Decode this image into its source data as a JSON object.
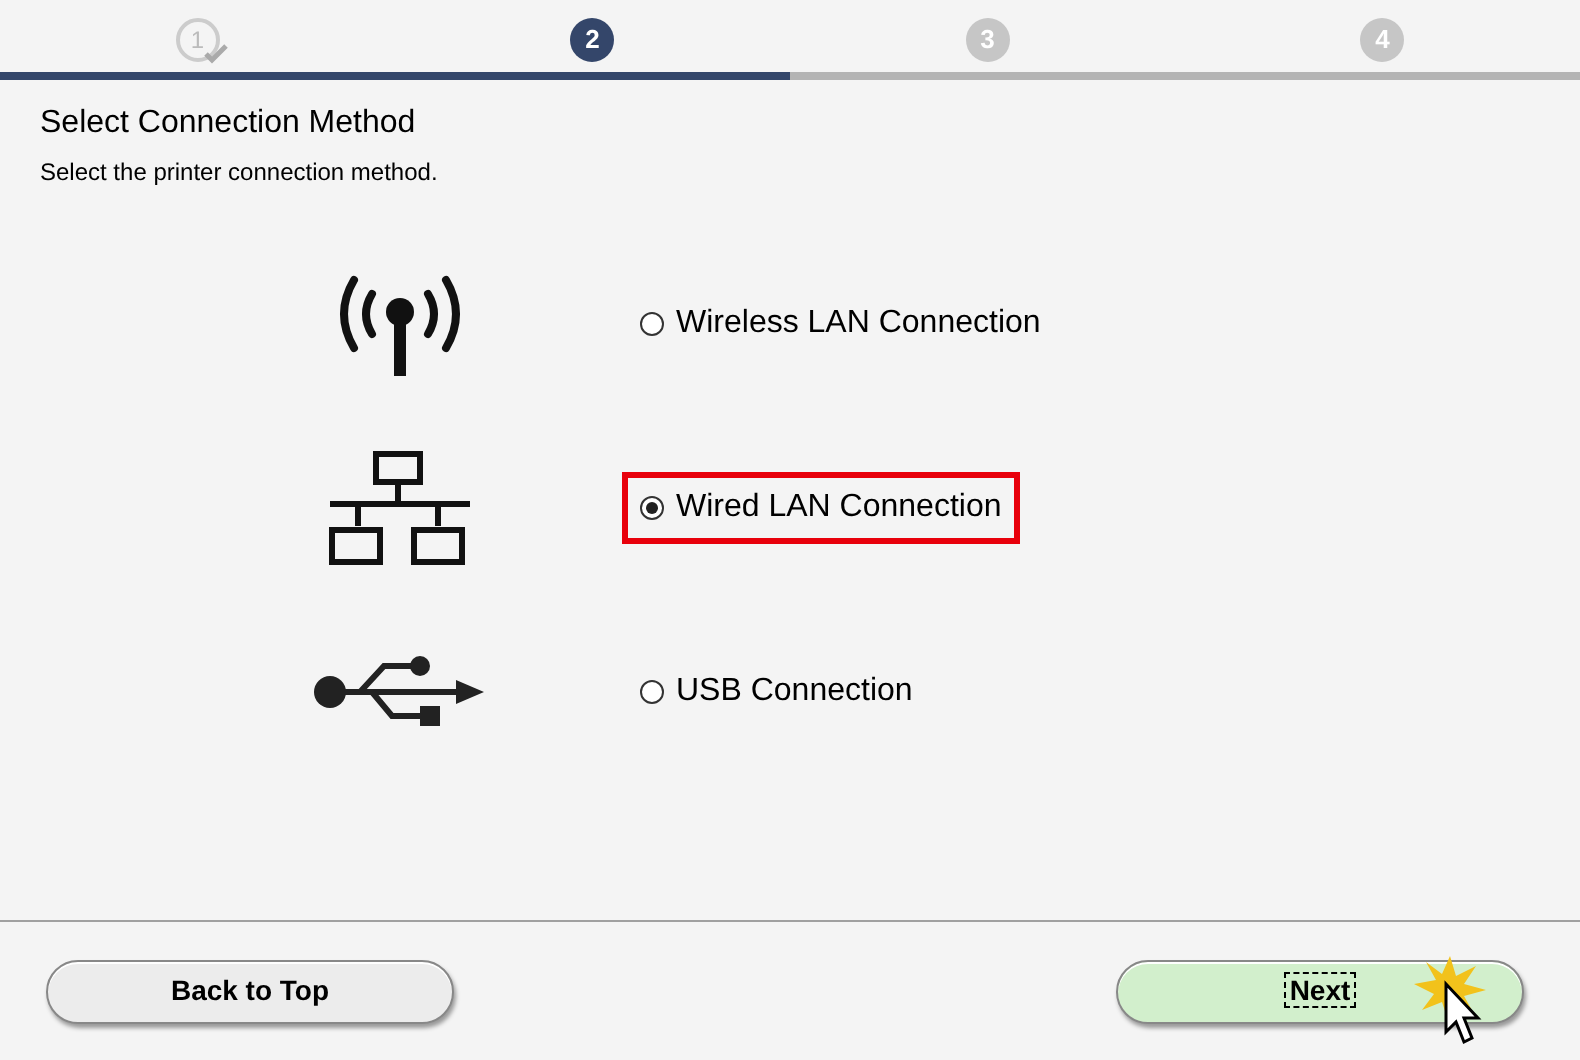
{
  "steps": [
    {
      "label": "1",
      "completed": true,
      "selected": false
    },
    {
      "label": "2",
      "completed": false,
      "selected": true
    },
    {
      "label": "3",
      "completed": false,
      "selected": false
    },
    {
      "label": "4",
      "completed": false,
      "selected": false
    }
  ],
  "title": "Select Connection Method",
  "subtitle": "Select the printer connection method.",
  "options": [
    {
      "kind": "wireless",
      "label": "Wireless LAN Connection",
      "selected": false,
      "highlighted": false
    },
    {
      "kind": "wired",
      "label": "Wired LAN Connection",
      "selected": true,
      "highlighted": true
    },
    {
      "kind": "usb",
      "label": "USB Connection",
      "selected": false,
      "highlighted": false
    }
  ],
  "buttons": [
    {
      "label": "Back to Top",
      "kind": "secondary",
      "focused": false
    },
    {
      "label": "Next",
      "kind": "primary",
      "focused": true
    }
  ]
}
